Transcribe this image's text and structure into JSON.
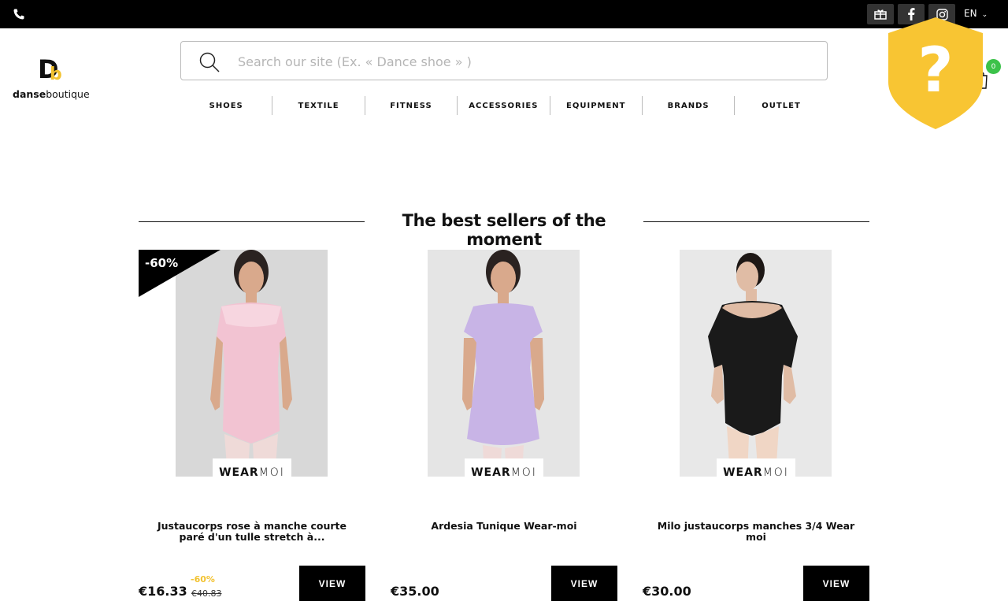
{
  "topbar": {
    "language": "EN",
    "icons": [
      "phone-icon",
      "gift-card-icon",
      "facebook-icon",
      "instagram-icon",
      "chevron-down-icon"
    ]
  },
  "logo": {
    "mark_d": "D",
    "mark_b": "b",
    "word_bold": "danse",
    "word_light": "boutique",
    "accent_color": "#f2c230"
  },
  "search": {
    "placeholder": "Search our site (Ex. « Dance shoe » )",
    "value": ""
  },
  "nav": {
    "items": [
      {
        "label": "SHOES"
      },
      {
        "label": "TEXTILE"
      },
      {
        "label": "FITNESS"
      },
      {
        "label": "ACCESSORIES"
      },
      {
        "label": "EQUIPMENT"
      },
      {
        "label": "BRANDS"
      },
      {
        "label": "OUTLET"
      }
    ]
  },
  "cart": {
    "count": "0",
    "badge_color": "#3cc24a"
  },
  "help": {
    "symbol": "?",
    "color": "#f8c533"
  },
  "section": {
    "title": "The best sellers of the moment"
  },
  "products": [
    {
      "badge": "-60%",
      "brand_a": "WEAR",
      "brand_b": "MOI",
      "name": "Justaucorps rose à manche courte paré d'un tulle stretch à...",
      "price": "€16.33",
      "discount": "-60%",
      "old_price": "€40.83",
      "button": "VIEW",
      "garment_color": "#f2c3d2"
    },
    {
      "brand_a": "WEAR",
      "brand_b": "MOI",
      "name": "Ardesia Tunique Wear-moi",
      "price": "€35.00",
      "button": "VIEW",
      "garment_color": "#c8b4e6"
    },
    {
      "brand_a": "WEAR",
      "brand_b": "MOI",
      "name": "Milo justaucorps manches 3/4 Wear moi",
      "price": "€30.00",
      "button": "VIEW",
      "garment_color": "#1a1a1a"
    }
  ]
}
